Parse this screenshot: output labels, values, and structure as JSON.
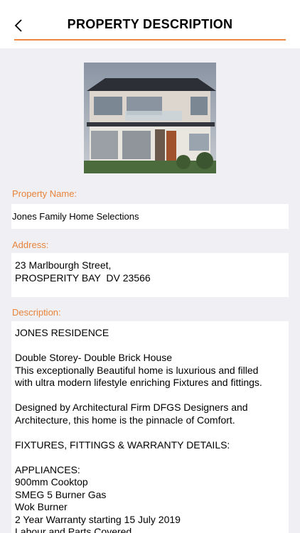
{
  "header": {
    "title": "PROPERTY DESCRIPTION",
    "back_icon": "chevron-left-icon"
  },
  "colors": {
    "accent": "#f0883e",
    "label": "#e8833a",
    "background": "#efeff4"
  },
  "property": {
    "name_label": "Property Name:",
    "name": "Jones Family Home Selections",
    "address_label": "Address:",
    "address_line1": "23 Marlbourgh Street,",
    "address_line2": "PROSPERITY BAY  DV 23566",
    "description_label": "Description:",
    "description": {
      "p1": "JONES RESIDENCE",
      "p2a": "Double Storey- Double Brick House",
      "p2b": "This exceptionally Beautiful home is luxurious and filled",
      "p2c": "with ultra modern lifestyle enriching Fixtures and fittings.",
      "p3a": "Designed by Architectural Firm DFGS Designers and",
      "p3b": "Architecture, this home is the pinnacle of Comfort.",
      "p4": "FIXTURES, FITTINGS & WARRANTY DETAILS:",
      "p5a": "APPLIANCES:",
      "p5b": "900mm Cooktop",
      "p5c": "SMEG 5 Burner Gas",
      "p5d": "Wok Burner",
      "p5e": "2 Year Warranty starting 15 July 2019",
      "p5f": "Labour and Parts Covered"
    }
  }
}
